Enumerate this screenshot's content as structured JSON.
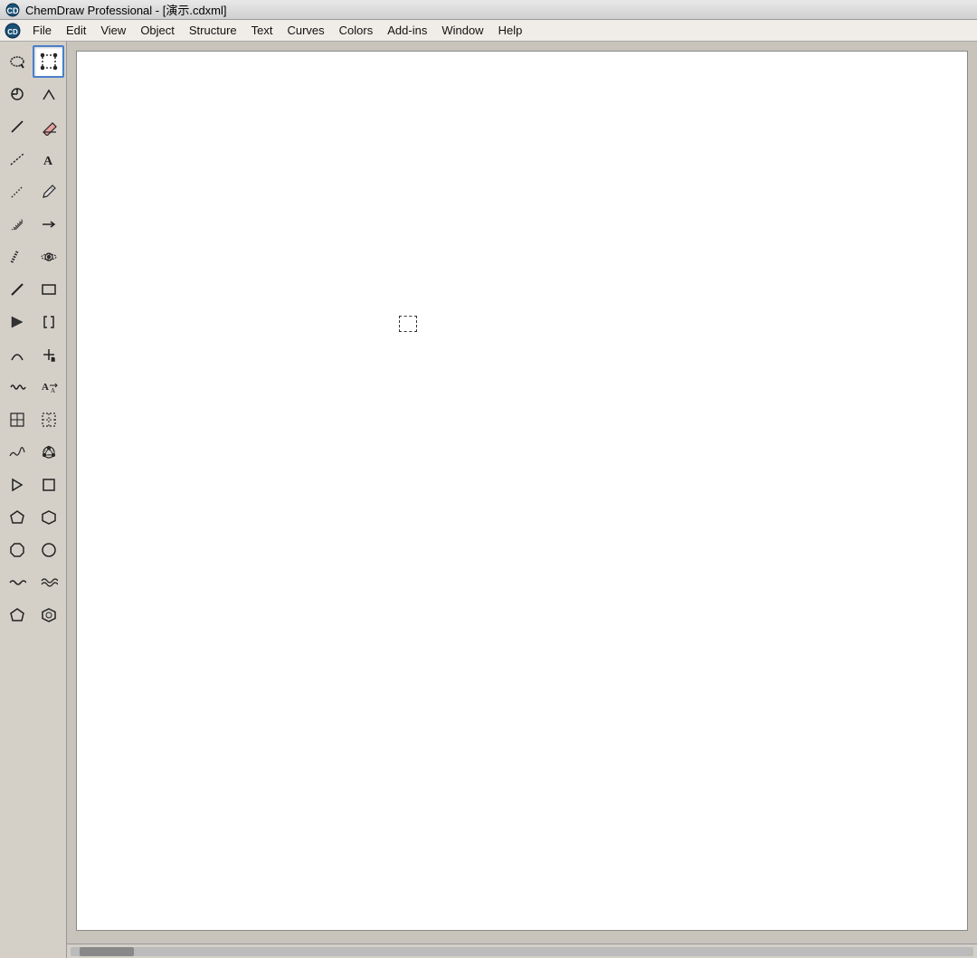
{
  "titleBar": {
    "appName": "ChemDraw Professional",
    "fileName": "[演示.cdxml]",
    "fullTitle": "ChemDraw Professional - [演示.cdxml]"
  },
  "menuBar": {
    "appIconLabel": "CD",
    "items": [
      {
        "id": "file",
        "label": "File"
      },
      {
        "id": "edit",
        "label": "Edit"
      },
      {
        "id": "view",
        "label": "View"
      },
      {
        "id": "object",
        "label": "Object"
      },
      {
        "id": "structure",
        "label": "Structure"
      },
      {
        "id": "text",
        "label": "Text"
      },
      {
        "id": "curves",
        "label": "Curves"
      },
      {
        "id": "colors",
        "label": "Colors"
      },
      {
        "id": "addins",
        "label": "Add-ins"
      },
      {
        "id": "window",
        "label": "Window"
      },
      {
        "id": "help",
        "label": "Help"
      }
    ]
  },
  "toolbar": {
    "tools": [
      [
        {
          "id": "lasso",
          "icon": "⊙",
          "name": "Lasso Select"
        },
        {
          "id": "marquee",
          "icon": "▣",
          "name": "Marquee Select",
          "active": true
        }
      ],
      [
        {
          "id": "rotate",
          "icon": "⊕",
          "name": "Rotate"
        },
        {
          "id": "bond-angle",
          "icon": "⌐",
          "name": "Bond Angle"
        }
      ],
      [
        {
          "id": "bond",
          "icon": "/",
          "name": "Bond Tool"
        },
        {
          "id": "eraser",
          "icon": "◨",
          "name": "Eraser"
        }
      ],
      [
        {
          "id": "wavy-bond",
          "icon": "≋",
          "name": "Wavy Bond"
        },
        {
          "id": "text",
          "icon": "A",
          "name": "Text"
        }
      ],
      [
        {
          "id": "dashed-bond",
          "icon": "⋯",
          "name": "Dashed Bond"
        },
        {
          "id": "pen",
          "icon": "✏",
          "name": "Pen"
        }
      ],
      [
        {
          "id": "hash-bond",
          "icon": "≡",
          "name": "Hash Bond"
        },
        {
          "id": "arrow",
          "icon": "→",
          "name": "Arrow"
        }
      ],
      [
        {
          "id": "bold-hash",
          "icon": "≣",
          "name": "Bold Hash"
        },
        {
          "id": "flower",
          "icon": "✾",
          "name": "Orbital"
        }
      ],
      [
        {
          "id": "line",
          "icon": "╲",
          "name": "Line"
        },
        {
          "id": "rect",
          "icon": "▭",
          "name": "Rectangle"
        }
      ],
      [
        {
          "id": "wedge",
          "icon": "◣",
          "name": "Wedge Bond"
        },
        {
          "id": "bracket",
          "icon": "[",
          "name": "Bracket"
        }
      ],
      [
        {
          "id": "curve-bond",
          "icon": "⌒",
          "name": "Curve Bond"
        },
        {
          "id": "plus",
          "icon": "+",
          "name": "Atom Map"
        }
      ],
      [
        {
          "id": "squiggle",
          "icon": "〜",
          "name": "Squiggle Bond"
        },
        {
          "id": "resize",
          "icon": "A↑",
          "name": "Resize Text"
        }
      ],
      [
        {
          "id": "grid-table",
          "icon": "⊞",
          "name": "Grid Table"
        },
        {
          "id": "table-dashed",
          "icon": "⊟",
          "name": "Dashed Table"
        }
      ],
      [
        {
          "id": "spectro",
          "icon": "∿",
          "name": "Spectrum"
        },
        {
          "id": "3d",
          "icon": "⚇",
          "name": "3D"
        }
      ],
      [
        {
          "id": "play",
          "icon": "▷",
          "name": "Play"
        },
        {
          "id": "small-rect",
          "icon": "□",
          "name": "Small Rectangle"
        }
      ],
      [
        {
          "id": "pentagon",
          "icon": "⬠",
          "name": "Pentagon"
        },
        {
          "id": "hexagon",
          "icon": "⬡",
          "name": "Hexagon"
        }
      ],
      [
        {
          "id": "octagon",
          "icon": "⬡",
          "name": "Octagon"
        },
        {
          "id": "circle",
          "icon": "○",
          "name": "Circle"
        }
      ],
      [
        {
          "id": "wave1",
          "icon": "〜",
          "name": "Wave 1"
        },
        {
          "id": "wave2",
          "icon": "≈",
          "name": "Wave 2"
        }
      ],
      [
        {
          "id": "penta-ring",
          "icon": "⬠",
          "name": "Pentagon Ring"
        },
        {
          "id": "hexa-ring",
          "icon": "⬡",
          "name": "Hexagon Ring"
        }
      ]
    ]
  },
  "canvas": {
    "backgroundColor": "#ffffff"
  }
}
